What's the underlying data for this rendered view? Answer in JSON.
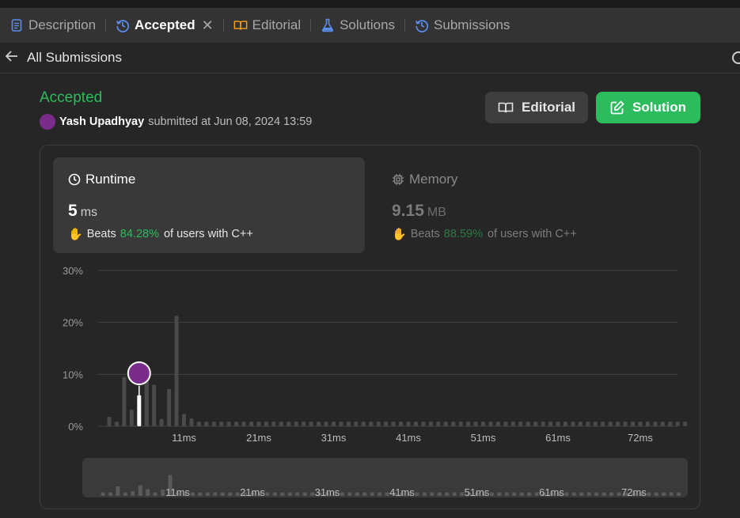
{
  "tabs": [
    {
      "label": "Description",
      "icon": "document-icon",
      "color": "#5b8def",
      "active": false
    },
    {
      "label": "Accepted",
      "icon": "history-icon",
      "color": "#5b8def",
      "active": true,
      "closable": true
    },
    {
      "label": "Editorial",
      "icon": "book-icon",
      "color": "#ffa116",
      "active": false
    },
    {
      "label": "Solutions",
      "icon": "flask-icon",
      "color": "#5b8def",
      "active": false
    },
    {
      "label": "Submissions",
      "icon": "history-icon",
      "color": "#5b8def",
      "active": false
    }
  ],
  "tab_close": "✕",
  "back": {
    "label": "All Submissions"
  },
  "submission": {
    "status": "Accepted",
    "user": "Yash Upadhyay",
    "avatar_text": "Yash Upadhyay",
    "submitted_text": "submitted at Jun 08, 2024 13:59"
  },
  "buttons": {
    "editorial": "Editorial",
    "solution": "Solution"
  },
  "runtime": {
    "title": "Runtime",
    "value": "5",
    "unit": "ms",
    "beats_label": "Beats",
    "beats_pct": "84.28%",
    "beats_suffix": "of users with C++"
  },
  "memory": {
    "title": "Memory",
    "value": "9.15",
    "unit": "MB",
    "beats_label": "Beats",
    "beats_pct": "88.59%",
    "beats_suffix": "of users with C++"
  },
  "colors": {
    "accent": "#2cbb5d",
    "bar": "#4a4a4a",
    "highlight": "#ffffff",
    "avatar": "#7a2c8a"
  },
  "chart_data": {
    "type": "bar",
    "ylabel": "",
    "xlabel": "",
    "yticks": [
      "0%",
      "10%",
      "20%",
      "30%"
    ],
    "ylim": [
      0,
      30
    ],
    "grid": true,
    "xtick_labels": [
      "11ms",
      "21ms",
      "31ms",
      "41ms",
      "51ms",
      "61ms",
      "72ms"
    ],
    "xtick_values": [
      11,
      21,
      31,
      41,
      51,
      61,
      72
    ],
    "x": [
      1,
      2,
      3,
      4,
      5,
      6,
      7,
      8,
      9,
      10,
      11,
      12,
      13,
      14,
      15,
      16,
      17,
      18,
      19,
      20,
      21,
      22,
      23,
      24,
      25,
      26,
      27,
      28,
      29,
      30,
      31,
      32,
      33,
      34,
      35,
      36,
      37,
      38,
      39,
      40,
      41,
      42,
      43,
      44,
      45,
      46,
      47,
      48,
      49,
      50,
      51,
      52,
      53,
      54,
      55,
      56,
      57,
      58,
      59,
      60,
      61,
      62,
      63,
      64,
      65,
      66,
      67,
      68,
      69,
      70,
      71,
      72,
      73,
      74,
      75,
      76,
      77,
      78
    ],
    "values": [
      1.8,
      0.9,
      9.5,
      3.2,
      6.0,
      9.8,
      8.0,
      1.4,
      7.2,
      21.3,
      2.4,
      1.5,
      0.9,
      0.9,
      0.9,
      0.9,
      0.9,
      0.9,
      0.9,
      0.9,
      0.9,
      0.9,
      0.9,
      0.9,
      0.9,
      0.9,
      0.9,
      0.9,
      0.9,
      0.9,
      0.9,
      0.9,
      0.9,
      0.9,
      0.9,
      0.9,
      0.9,
      0.9,
      0.9,
      0.9,
      0.9,
      0.9,
      0.9,
      0.9,
      0.9,
      0.9,
      0.9,
      0.9,
      0.9,
      0.9,
      0.9,
      0.9,
      0.9,
      0.9,
      0.9,
      0.9,
      0.9,
      0.9,
      0.9,
      0.9,
      0.9,
      0.9,
      0.9,
      0.9,
      0.9,
      0.9,
      0.9,
      0.9,
      0.9,
      0.9,
      0.9,
      0.9,
      0.9,
      0.9,
      0.9,
      0.9,
      0.9,
      0.9
    ],
    "highlight_x": 5,
    "overview_values": [
      0.9,
      0.9,
      2.5,
      0.9,
      1.2,
      2.8,
      1.8,
      0.9,
      1.7,
      5.5,
      0.9,
      0.9,
      0.9,
      0.9,
      0.9,
      0.9,
      0.9,
      0.9,
      0.9,
      0.9,
      0.9,
      0.9,
      0.9,
      0.9,
      0.9,
      0.9,
      0.9,
      0.9,
      0.9,
      0.9,
      0.9,
      0.9,
      0.9,
      0.9,
      0.9,
      0.9,
      0.9,
      0.9,
      0.9,
      0.9,
      0.9,
      0.9,
      0.9,
      0.9,
      0.9,
      0.9,
      0.9,
      0.9,
      0.9,
      0.9,
      0.9,
      0.9,
      0.9,
      0.9,
      0.9,
      0.9,
      0.9,
      0.9,
      0.9,
      0.9,
      0.9,
      0.9,
      0.9,
      0.9,
      0.9,
      0.9,
      0.9,
      0.9,
      0.9,
      0.9,
      0.9,
      0.9,
      0.9,
      0.9,
      0.9,
      0.9,
      0.9,
      0.9
    ]
  }
}
